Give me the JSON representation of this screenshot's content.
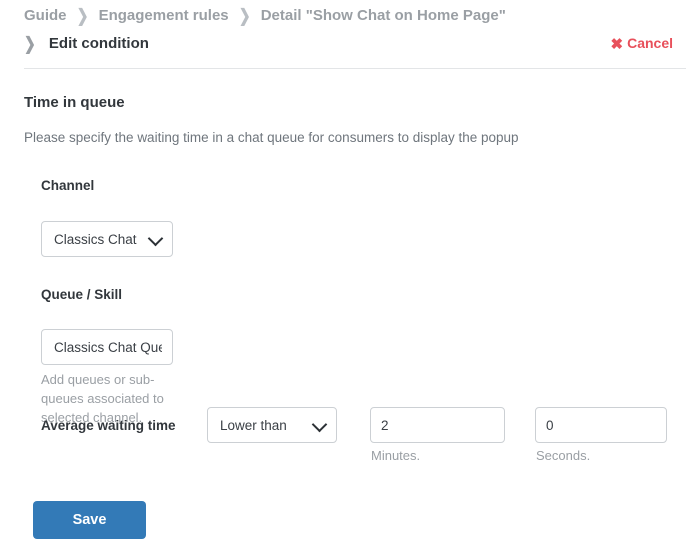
{
  "header": {
    "breadcrumb": [
      {
        "label": "Guide"
      },
      {
        "label": "Engagement rules"
      },
      {
        "label": "Detail \"Show Chat on Home Page\""
      }
    ],
    "separator": "❯",
    "sub_breadcrumb": {
      "chevron": "❯",
      "label": "Edit condition"
    },
    "cancel": {
      "icon": "✖",
      "label": "Cancel"
    }
  },
  "main": {
    "section_title": "Time in queue",
    "section_description": "Please specify the waiting time in a chat queue for consumers to display the popup",
    "fields": {
      "channel": {
        "label": "Channel",
        "selected": "Classics Chat",
        "options": [
          "Classics Chat"
        ]
      },
      "queue_skill": {
        "label": "Queue / Skill",
        "value": "Classics Chat Queue",
        "placeholder": "",
        "helper_text": "Add queues or sub-queues associated to selected channel."
      },
      "average_waiting_time": {
        "label": "Average waiting time",
        "operator": {
          "selected": "Lower than",
          "options": [
            "Lower than"
          ]
        },
        "minutes": {
          "value": "2",
          "unit_label": "Minutes."
        },
        "seconds": {
          "value": "0",
          "unit_label": "Seconds."
        }
      }
    },
    "save_label": "Save"
  }
}
